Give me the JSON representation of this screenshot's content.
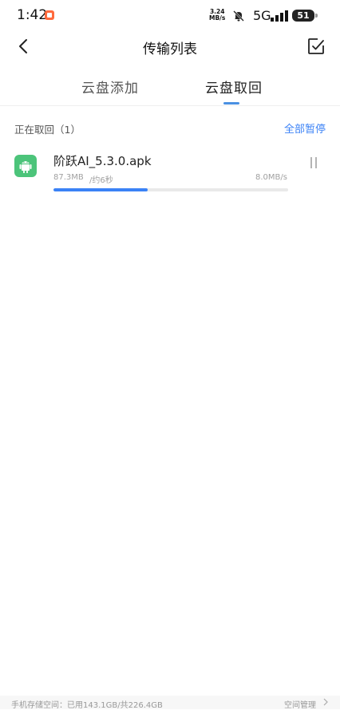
{
  "status_bar": {
    "time": "1:42",
    "speed_value": "3.24",
    "speed_unit": "MB/s",
    "network": "5G",
    "battery": "51"
  },
  "header": {
    "title": "传输列表"
  },
  "tabs": [
    {
      "label": "云盘添加",
      "active": false
    },
    {
      "label": "云盘取回",
      "active": true
    }
  ],
  "section": {
    "title": "正在取回（1）",
    "pause_all": "全部暂停"
  },
  "task": {
    "file_name": "阶跃AI_5.3.0.apk",
    "size": "87.3MB",
    "eta": "/约6秒",
    "speed": "8.0MB/s",
    "progress_percent": 40
  },
  "footer": {
    "storage": "手机存储空间：已用143.1GB/共226.4GB",
    "manage": "空间管理"
  },
  "colors": {
    "accent": "#3b82f6",
    "apk_icon": "#4cc47a"
  }
}
